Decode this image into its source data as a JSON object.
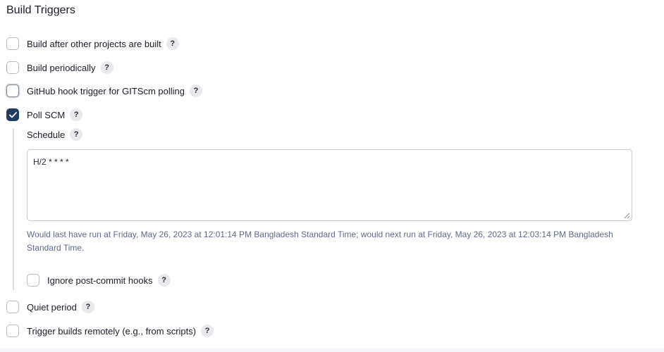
{
  "section": {
    "title": "Build Triggers"
  },
  "triggers": [
    {
      "label": "Build after other projects are built",
      "checked": false
    },
    {
      "label": "Build periodically",
      "checked": false
    },
    {
      "label": "GitHub hook trigger for GITScm polling",
      "checked": false
    },
    {
      "label": "Poll SCM",
      "checked": true
    }
  ],
  "poll_scm": {
    "schedule_label": "Schedule",
    "schedule_value": "H/2 * * * *",
    "hint": "Would last have run at Friday, May 26, 2023 at 12:01:14 PM Bangladesh Standard Time; would next run at Friday, May 26, 2023 at 12:03:14 PM Bangladesh Standard Time.",
    "ignore_hooks_label": "Ignore post-commit hooks",
    "ignore_hooks_checked": false
  },
  "more_triggers": [
    {
      "label": "Quiet period",
      "checked": false
    },
    {
      "label": "Trigger builds remotely (e.g., from scripts)",
      "checked": false
    }
  ],
  "help_glyph": "?",
  "colors": {
    "accent": "#1f3d5c",
    "hint_text": "#5e6a8a"
  }
}
